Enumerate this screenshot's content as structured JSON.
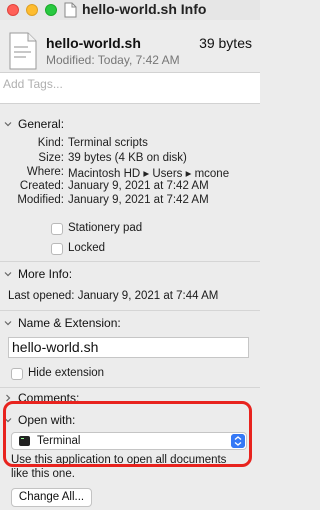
{
  "window": {
    "title": "hello-world.sh Info"
  },
  "header": {
    "file_name": "hello-world.sh",
    "file_size": "39 bytes",
    "modified": "Modified: Today, 7:42 AM"
  },
  "tags": {
    "placeholder": "Add Tags..."
  },
  "general": {
    "label": "General:",
    "rows": [
      {
        "key": "Kind:",
        "value": "Terminal scripts"
      },
      {
        "key": "Size:",
        "value": "39 bytes (4 KB on disk)"
      },
      {
        "key": "Where:",
        "value": "Macintosh HD ▸ Users ▸ mcone"
      },
      {
        "key": "Created:",
        "value": "January 9, 2021 at 7:42 AM"
      },
      {
        "key": "Modified:",
        "value": "January 9, 2021 at 7:42 AM"
      }
    ],
    "stationery_label": "Stationery pad",
    "stationery_checked": false,
    "locked_label": "Locked",
    "locked_checked": false
  },
  "more_info": {
    "label": "More Info:",
    "last_opened": "Last opened: January 9, 2021 at 7:44 AM"
  },
  "name_ext": {
    "label": "Name & Extension:",
    "value": "hello-world.sh",
    "hide_extension_label": "Hide extension",
    "hide_extension_checked": false
  },
  "comments": {
    "label": "Comments:"
  },
  "open_with": {
    "label": "Open with:",
    "app": "Terminal",
    "description_line1": "Use this application to open all documents",
    "description_line2": "like this one.",
    "change_all_label": "Change All..."
  },
  "colors": {
    "highlight": "#e8231e",
    "accent": "#3478f6"
  }
}
